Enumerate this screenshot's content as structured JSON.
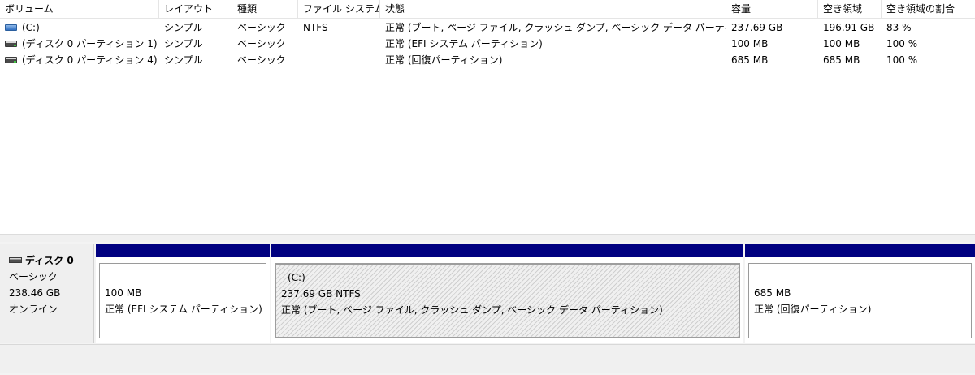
{
  "columns": [
    {
      "key": "volume",
      "label": "ボリューム"
    },
    {
      "key": "layout",
      "label": "レイアウト"
    },
    {
      "key": "type",
      "label": "種類"
    },
    {
      "key": "filesystem",
      "label": "ファイル システム"
    },
    {
      "key": "status",
      "label": "状態"
    },
    {
      "key": "capacity",
      "label": "容量"
    },
    {
      "key": "free",
      "label": "空き領域"
    },
    {
      "key": "free_pct",
      "label": "空き領域の割合"
    }
  ],
  "volumes": [
    {
      "volume": "(C:)",
      "icon": "blue-volume-icon",
      "layout": "シンプル",
      "type": "ベーシック",
      "filesystem": "NTFS",
      "status": "正常 (ブート, ページ ファイル, クラッシュ ダンプ, ベーシック データ パーティション)",
      "capacity": "237.69 GB",
      "free": "196.91 GB",
      "free_pct": "83 %"
    },
    {
      "volume": "(ディスク 0 パーティション 1)",
      "icon": "gray-volume-icon",
      "layout": "シンプル",
      "type": "ベーシック",
      "filesystem": "",
      "status": "正常 (EFI システム パーティション)",
      "capacity": "100 MB",
      "free": "100 MB",
      "free_pct": "100 %"
    },
    {
      "volume": "(ディスク 0 パーティション 4)",
      "icon": "gray-volume-icon",
      "layout": "シンプル",
      "type": "ベーシック",
      "filesystem": "",
      "status": "正常 (回復パーティション)",
      "capacity": "685 MB",
      "free": "685 MB",
      "free_pct": "100 %"
    }
  ],
  "disk": {
    "name": "ディスク 0",
    "type": "ベーシック",
    "size": "238.46 GB",
    "state": "オンライン",
    "partitions": [
      {
        "name": "",
        "size": "100 MB",
        "status": "正常 (EFI システム パーティション)",
        "selected": false,
        "bar_color": "#000080"
      },
      {
        "name": "(C:)",
        "size": "237.69 GB NTFS",
        "status": "正常 (ブート, ページ ファイル, クラッシュ ダンプ, ベーシック データ パーティション)",
        "selected": true,
        "bar_color": "#000080"
      },
      {
        "name": "",
        "size": "685 MB",
        "status": "正常 (回復パーティション)",
        "selected": false,
        "bar_color": "#000080"
      }
    ]
  }
}
